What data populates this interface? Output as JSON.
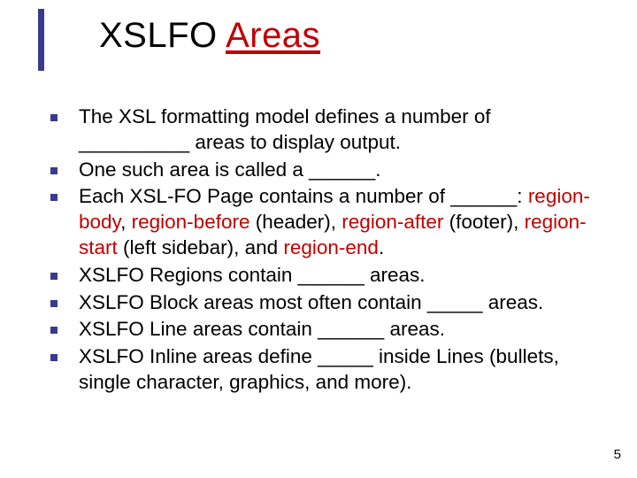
{
  "title": {
    "word1": "XSLFO",
    "word2": "Areas"
  },
  "bullets": [
    {
      "html": "The XSL formatting model defines a number of __________ areas to display output."
    },
    {
      "html": "One such area is called a ______."
    },
    {
      "html": "Each XSL-FO Page contains a number of ______: <span class=\"red\">region-body</span>, <span class=\"red\">region-before</span> (header), <span class=\"red\">region-after</span> (footer), <span class=\"red\">region-start</span> (left sidebar), and <span class=\"red\">region-end</span>."
    },
    {
      "html": "XSLFO Regions contain ______ areas."
    },
    {
      "html": "XSLFO Block areas most often contain _____ areas."
    },
    {
      "html": "XSLFO Line areas contain ______ areas."
    },
    {
      "html": "XSLFO Inline areas define _____ inside Lines (bullets, single character, graphics, and more)."
    }
  ],
  "page_number": "5"
}
